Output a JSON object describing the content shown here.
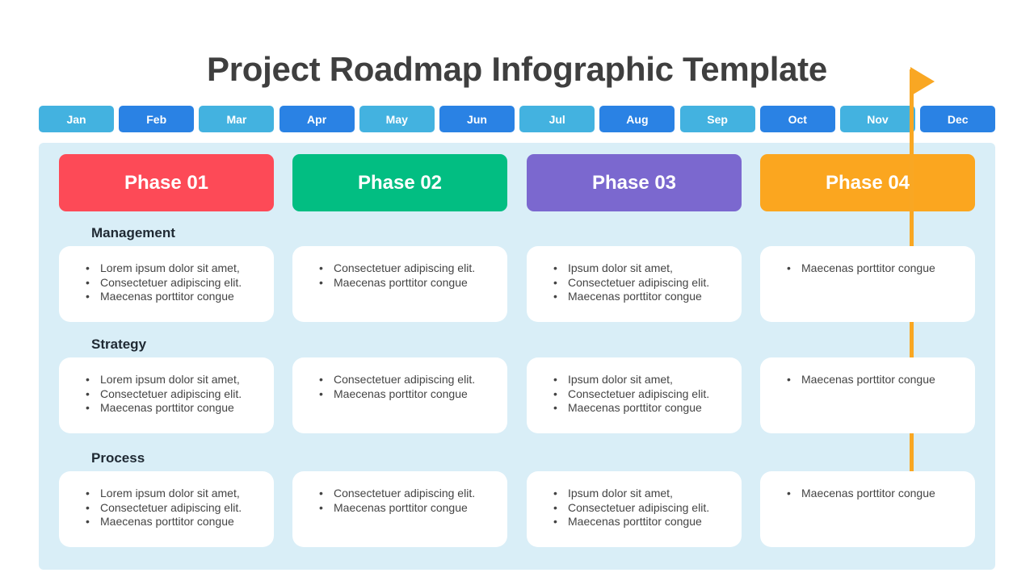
{
  "title": "Project Roadmap Infographic Template",
  "colors": {
    "month_light": "#43b2e0",
    "month_dark": "#2a82e4",
    "panel": "#d9eef7",
    "flag": "#f9a723"
  },
  "flag_marker": {
    "icon": "flag-icon",
    "month": "Nov"
  },
  "months": [
    {
      "label": "Jan",
      "shade": "light"
    },
    {
      "label": "Feb",
      "shade": "dark"
    },
    {
      "label": "Mar",
      "shade": "light"
    },
    {
      "label": "Apr",
      "shade": "dark"
    },
    {
      "label": "May",
      "shade": "light"
    },
    {
      "label": "Jun",
      "shade": "dark"
    },
    {
      "label": "Jul",
      "shade": "light"
    },
    {
      "label": "Aug",
      "shade": "dark"
    },
    {
      "label": "Sep",
      "shade": "light"
    },
    {
      "label": "Oct",
      "shade": "dark"
    },
    {
      "label": "Nov",
      "shade": "light"
    },
    {
      "label": "Dec",
      "shade": "dark"
    }
  ],
  "phases": [
    {
      "label": "Phase 01",
      "color": "#fd4a57"
    },
    {
      "label": "Phase 02",
      "color": "#02be82"
    },
    {
      "label": "Phase 03",
      "color": "#7b68cf"
    },
    {
      "label": "Phase 04",
      "color": "#fba61f"
    }
  ],
  "sections": [
    {
      "label": "Management",
      "cards": [
        [
          "Lorem ipsum dolor sit amet,",
          "Consectetuer adipiscing elit.",
          "Maecenas porttitor congue"
        ],
        [
          "Consectetuer adipiscing elit.",
          "Maecenas porttitor congue"
        ],
        [
          "Ipsum dolor sit amet,",
          "Consectetuer adipiscing elit.",
          "Maecenas porttitor congue"
        ],
        [
          "Maecenas porttitor congue"
        ]
      ]
    },
    {
      "label": "Strategy",
      "cards": [
        [
          "Lorem ipsum dolor sit amet,",
          "Consectetuer adipiscing elit.",
          "Maecenas porttitor congue"
        ],
        [
          "Consectetuer adipiscing elit.",
          "Maecenas porttitor congue"
        ],
        [
          "Ipsum dolor sit amet,",
          "Consectetuer adipiscing elit.",
          "Maecenas porttitor congue"
        ],
        [
          "Maecenas porttitor congue"
        ]
      ]
    },
    {
      "label": "Process",
      "cards": [
        [
          "Lorem ipsum dolor sit amet,",
          "Consectetuer adipiscing elit.",
          "Maecenas porttitor congue"
        ],
        [
          "Consectetuer adipiscing elit.",
          "Maecenas porttitor congue"
        ],
        [
          "Ipsum dolor sit amet,",
          "Consectetuer adipiscing elit.",
          "Maecenas porttitor congue"
        ],
        [
          "Maecenas porttitor congue"
        ]
      ]
    }
  ]
}
